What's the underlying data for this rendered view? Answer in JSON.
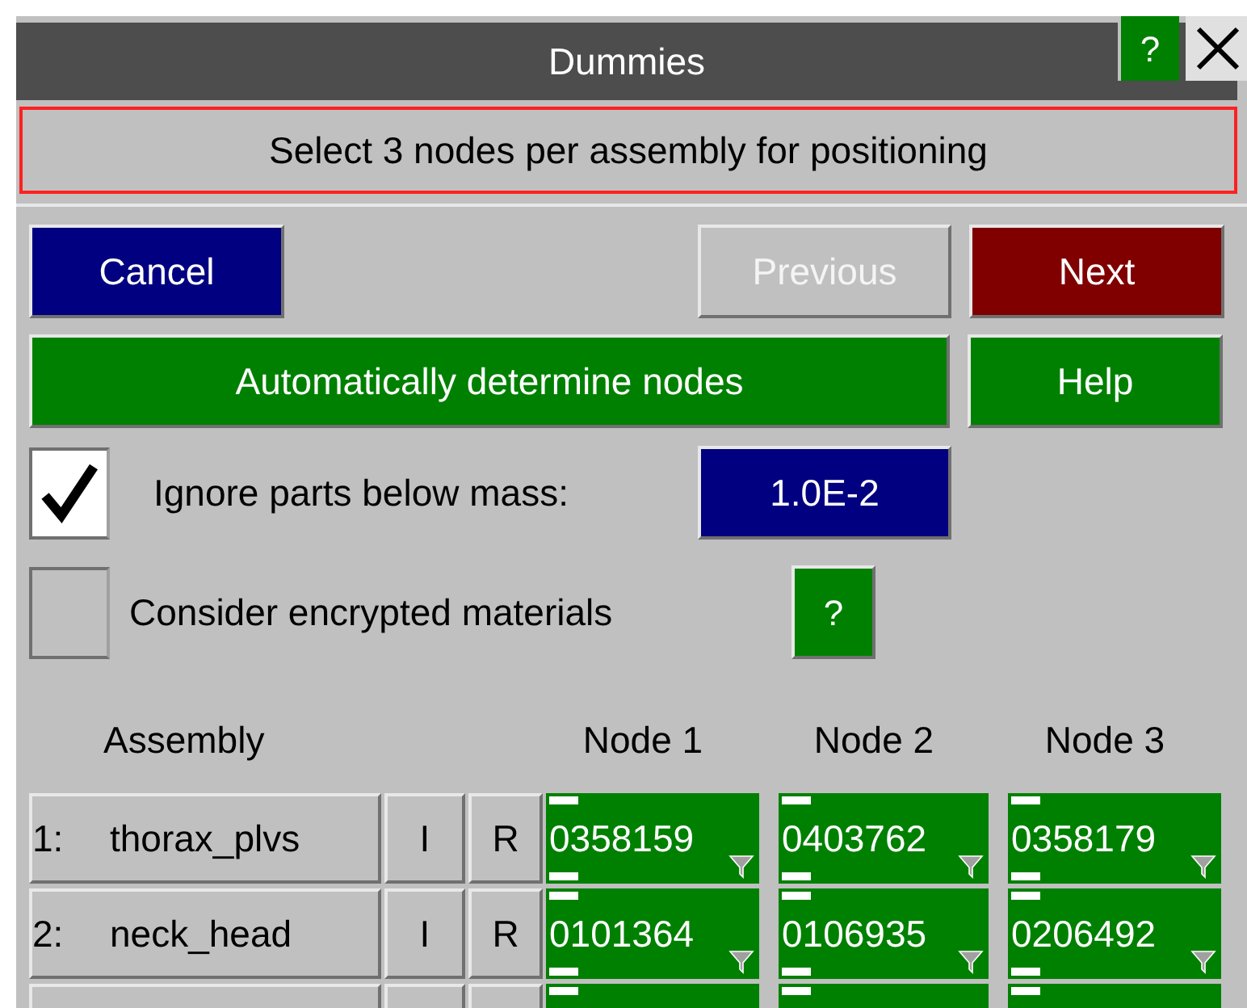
{
  "window": {
    "title": "Dummies",
    "help": "?"
  },
  "message": "Select 3 nodes per assembly for positioning",
  "buttons": [
    {
      "label": "Cancel",
      "kind": "cancel",
      "disabled": false
    },
    {
      "label": "Previous",
      "kind": "previous",
      "disabled": true
    },
    {
      "label": "Next",
      "kind": "next",
      "disabled": false
    }
  ],
  "auto_button": "Automatically determine nodes",
  "help_button": "Help",
  "options": [
    {
      "kind": "mass",
      "label": "Ignore parts below mass:",
      "checked": true,
      "value": "1.0E-2"
    },
    {
      "kind": "encrypted",
      "label": "Consider encrypted materials",
      "checked": false,
      "help": "?"
    }
  ],
  "table": {
    "columns": [
      "Assembly",
      "Node 1",
      "Node 2",
      "Node 3"
    ],
    "rows": [
      {
        "index": "1:",
        "name": "thorax_plvs",
        "i": "I",
        "r": "R",
        "nodes": [
          "0358159",
          "0403762",
          "0358179"
        ]
      },
      {
        "index": "2:",
        "name": "neck_head",
        "i": "I",
        "r": "R",
        "nodes": [
          "0101364",
          "0106935",
          "0206492"
        ]
      }
    ]
  }
}
